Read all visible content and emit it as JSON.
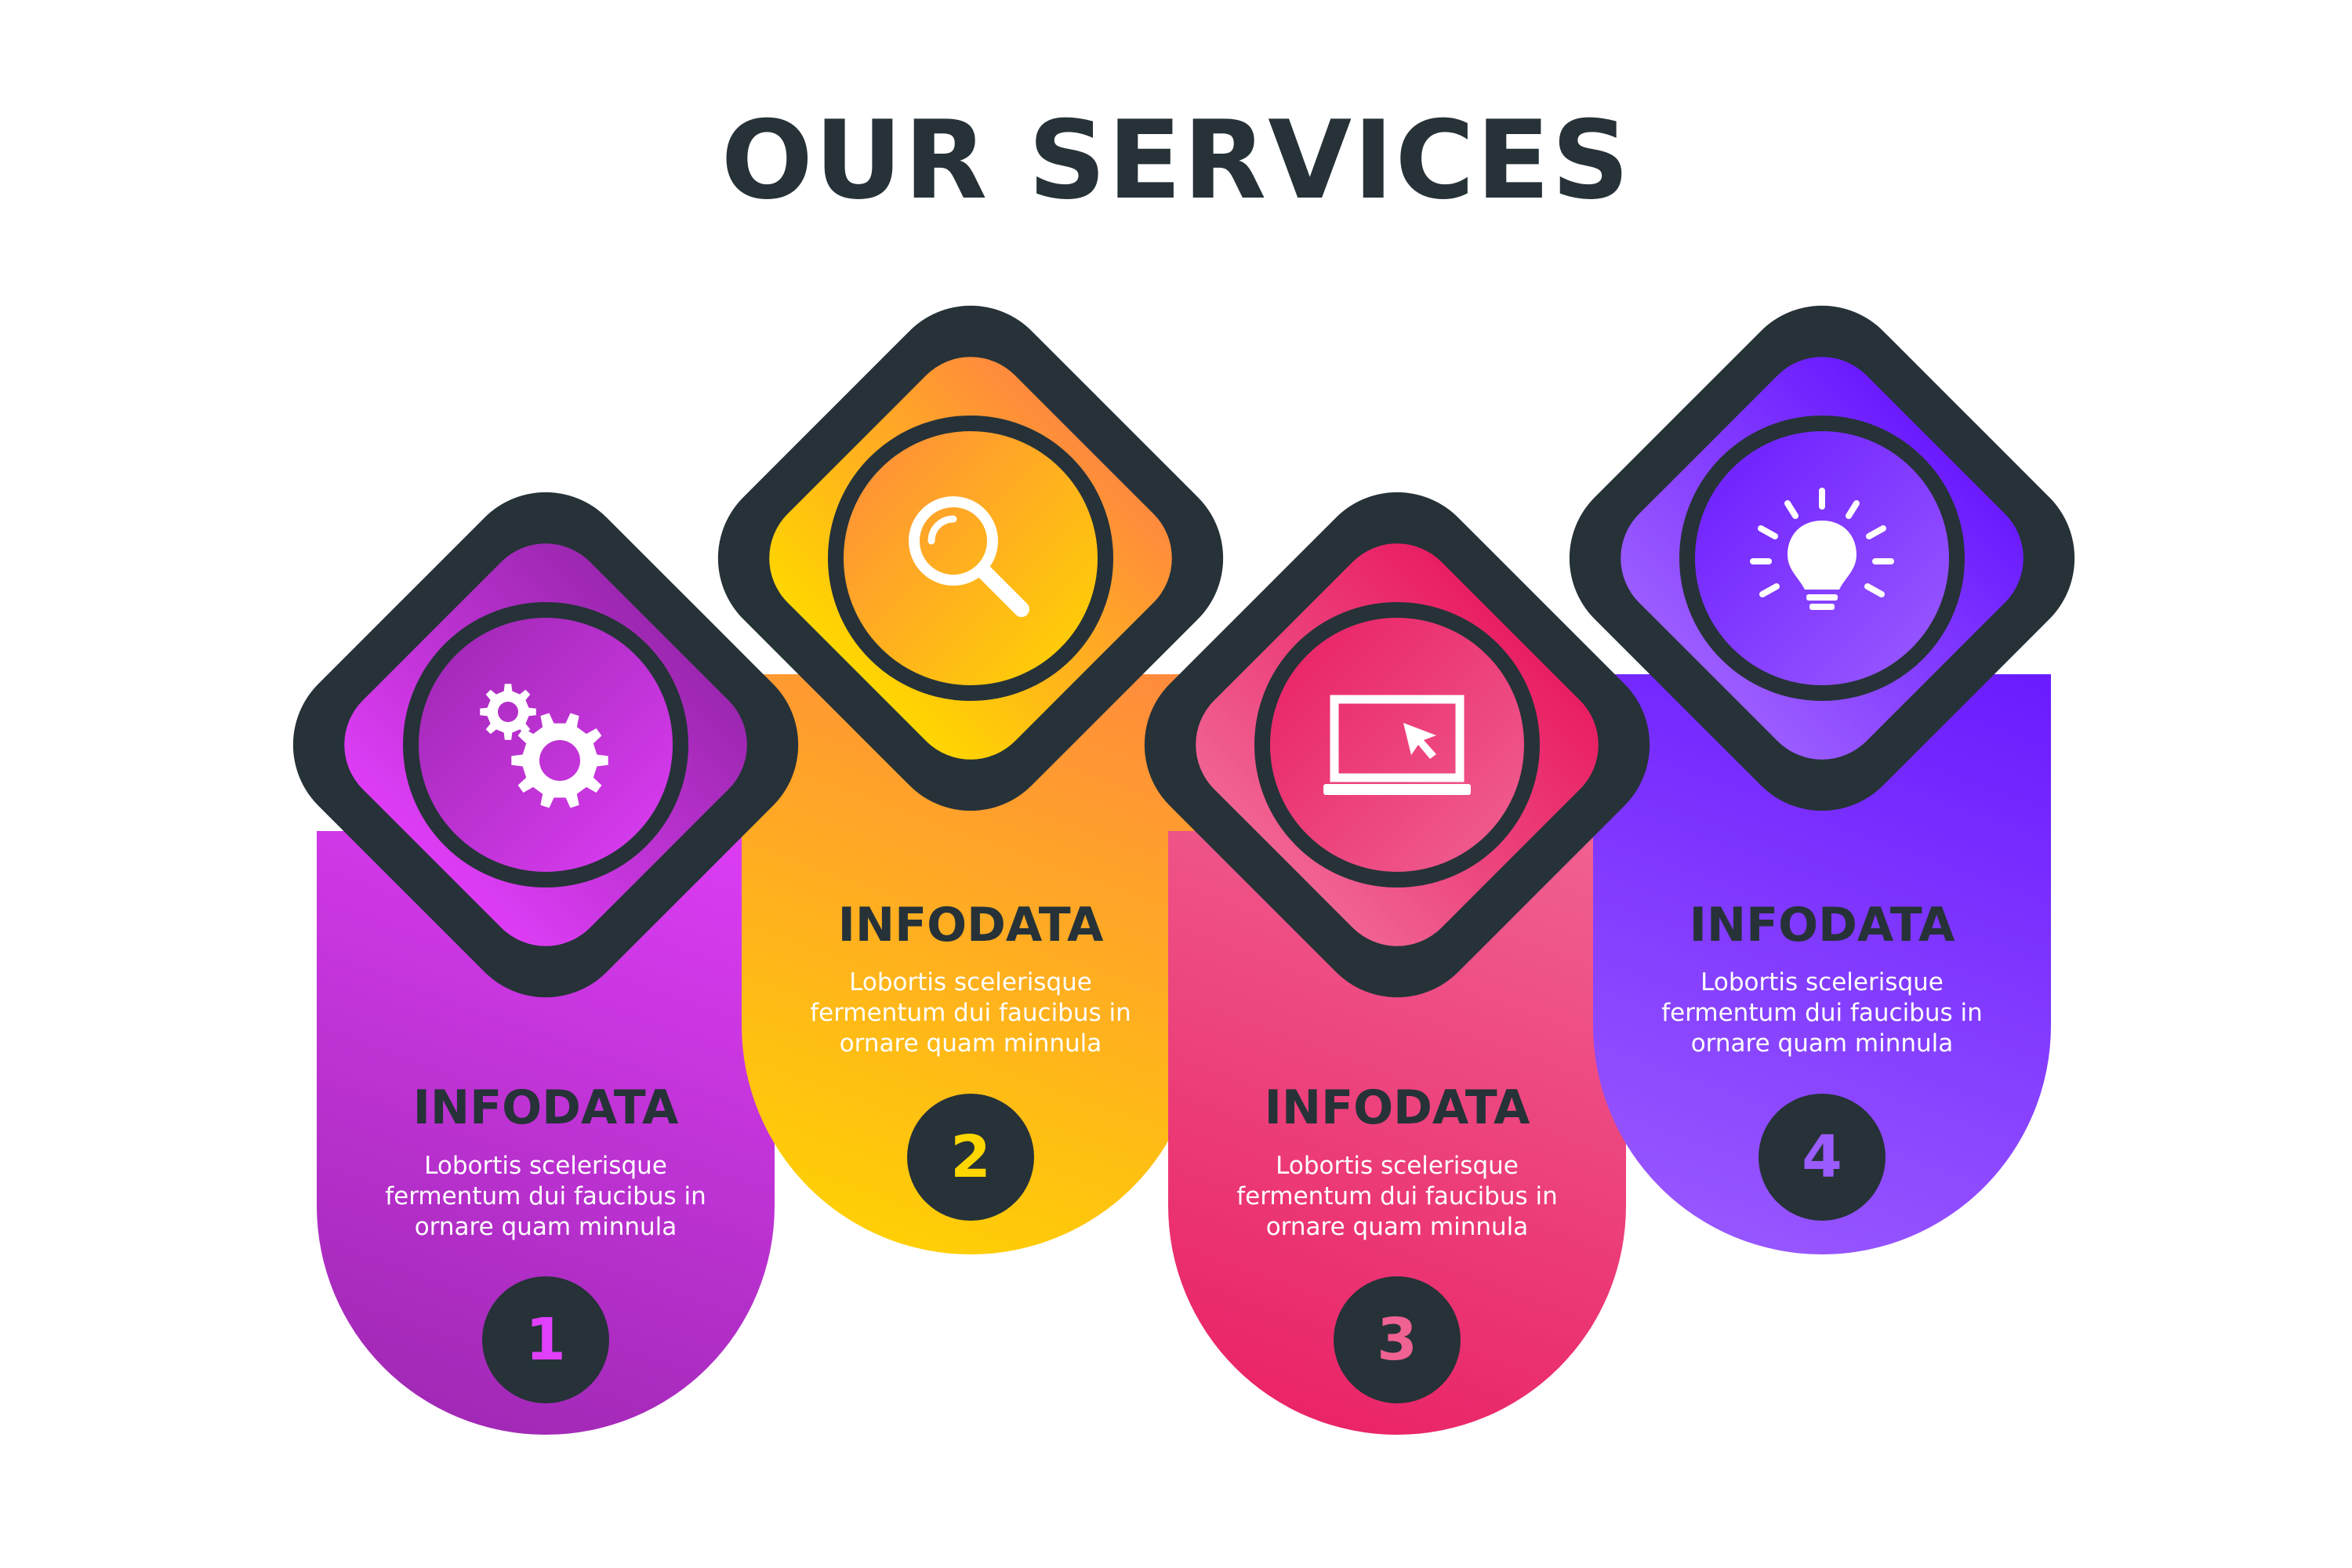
{
  "title": "OUR SERVICES",
  "colors": {
    "dark": "#263238",
    "text_light": "#ffffff",
    "background": "#ffffff",
    "purple_magenta": [
      "#dd3df5",
      "#9c27b0"
    ],
    "yellow_orange": [
      "#ffd600",
      "#ff8a3d"
    ],
    "pink_red": [
      "#f06292",
      "#e91e63"
    ],
    "violet": [
      "#9b5cff",
      "#6a1bff"
    ]
  },
  "cards": [
    {
      "number": "1",
      "icon": "gears-icon",
      "heading": "INFODATA",
      "desc_lines": [
        "Lobortis scelerisque",
        "fermentum dui faucibus in",
        "ornare quam minnula"
      ],
      "badge_text_color": "#e040fb"
    },
    {
      "number": "2",
      "icon": "magnifier-icon",
      "heading": "INFODATA",
      "desc_lines": [
        "Lobortis scelerisque",
        "fermentum dui faucibus in",
        "ornare quam minnula"
      ],
      "badge_text_color": "#ffd600"
    },
    {
      "number": "3",
      "icon": "laptop-cursor-icon",
      "heading": "INFODATA",
      "desc_lines": [
        "Lobortis scelerisque",
        "fermentum dui faucibus in",
        "ornare quam minnula"
      ],
      "badge_text_color": "#f06292"
    },
    {
      "number": "4",
      "icon": "lightbulb-icon",
      "heading": "INFODATA",
      "desc_lines": [
        "Lobortis scelerisque",
        "fermentum dui faucibus in",
        "ornare quam minnula"
      ],
      "badge_text_color": "#9b5cff"
    }
  ]
}
